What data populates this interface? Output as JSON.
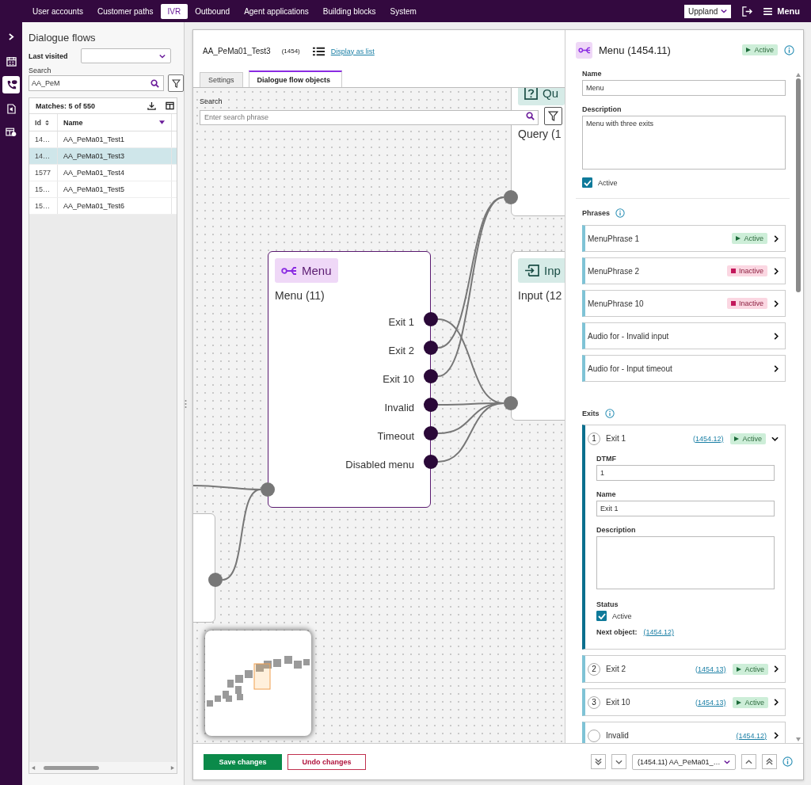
{
  "top_nav": {
    "items": [
      {
        "label": "User accounts",
        "selected": false
      },
      {
        "label": "Customer paths",
        "selected": false
      },
      {
        "label": "IVR",
        "selected": true
      },
      {
        "label": "Outbound",
        "selected": false
      },
      {
        "label": "Agent applications",
        "selected": false
      },
      {
        "label": "Building blocks",
        "selected": false
      },
      {
        "label": "System",
        "selected": false
      }
    ],
    "org_select": "Uppland",
    "menu_button": "Menu"
  },
  "rail": [
    {
      "kind": "expand",
      "selected": false
    },
    {
      "kind": "calendar",
      "selected": false
    },
    {
      "kind": "phone",
      "selected": true
    },
    {
      "kind": "audio-file",
      "selected": false
    },
    {
      "kind": "table",
      "selected": false
    }
  ],
  "sidebar": {
    "title": "Dialogue flows",
    "last_visited": {
      "label": "Last visited"
    },
    "search": {
      "label": "Search",
      "value": "AA_PeM"
    },
    "matches": "Matches: 5 of 550",
    "columns": [
      "Id",
      "Name"
    ],
    "rows": [
      {
        "id": "14…",
        "name": "AA_PeMa01_Test1",
        "selected": false
      },
      {
        "id": "14…",
        "name": "AA_PeMa01_Test3",
        "selected": true
      },
      {
        "id": "1577",
        "name": "AA_PeMa01_Test4",
        "selected": false
      },
      {
        "id": "15…",
        "name": "AA_PeMa01_Test5",
        "selected": false
      },
      {
        "id": "15…",
        "name": "AA_PeMa01_Test6",
        "selected": false
      }
    ]
  },
  "flow": {
    "title": "AA_PeMa01_Test3",
    "id": "(1454)",
    "list_link": "Display as list",
    "tabs": [
      {
        "label": "Settings",
        "selected": false
      },
      {
        "label": "Dialogue flow objects",
        "selected": true
      }
    ]
  },
  "canvas": {
    "search": {
      "label": "Search",
      "placeholder": "Enter search phrase"
    },
    "nodes": [
      {
        "kind": "query",
        "title": "Qu",
        "subtitle": "Query (1"
      },
      {
        "kind": "menu",
        "title": "Menu",
        "subtitle": "Menu (11)",
        "exits": [
          "Exit 1",
          "Exit 2",
          "Exit 10",
          "Invalid",
          "Timeout",
          "Disabled menu"
        ]
      },
      {
        "kind": "input",
        "title": "Inp",
        "subtitle": "Input (12"
      },
      {
        "kind": "stub"
      }
    ]
  },
  "details": {
    "title": "Menu (1454.11)",
    "status": {
      "label": "Active",
      "active": true
    },
    "name": {
      "label": "Name",
      "value": "Menu"
    },
    "description": {
      "label": "Description",
      "value": "Menu with three exits"
    },
    "active": {
      "label": "Active",
      "checked": true
    },
    "phrases_label": "Phrases",
    "phrases": [
      {
        "label": "MenuPhrase 1",
        "status": {
          "label": "Active",
          "active": true
        }
      },
      {
        "label": "MenuPhrase 2",
        "status": {
          "label": "Inactive",
          "active": false
        }
      },
      {
        "label": "MenuPhrase 10",
        "status": {
          "label": "Inactive",
          "active": false
        }
      },
      {
        "label": "Audio for - Invalid input"
      },
      {
        "label": "Audio for - Input timeout"
      }
    ],
    "exits_label": "Exits",
    "exits": [
      {
        "number": "1",
        "label": "Exit 1",
        "ref": "(1454.12)",
        "status": {
          "label": "Active",
          "active": true
        },
        "expanded": true,
        "dtmf": {
          "label": "DTMF",
          "value": "1"
        },
        "name": {
          "label": "Name",
          "value": "Exit 1"
        },
        "description": {
          "label": "Description"
        },
        "status_label": "Status",
        "active": {
          "label": "Active",
          "checked": true
        },
        "next_object": {
          "label": "Next object:",
          "ref": "(1454.12)"
        }
      },
      {
        "number": "2",
        "label": "Exit 2",
        "ref": "(1454.13)",
        "status": {
          "label": "Active",
          "active": true
        },
        "expanded": false
      },
      {
        "number": "3",
        "label": "Exit 10",
        "ref": "(1454.13)",
        "status": {
          "label": "Active",
          "active": true
        },
        "expanded": false
      },
      {
        "label": "Invalid",
        "ref": "(1454.12)",
        "expanded": false
      }
    ]
  },
  "footer": {
    "save": "Save changes",
    "undo": "Undo changes",
    "object_select": "(1454.11) AA_PeMa01_…"
  }
}
